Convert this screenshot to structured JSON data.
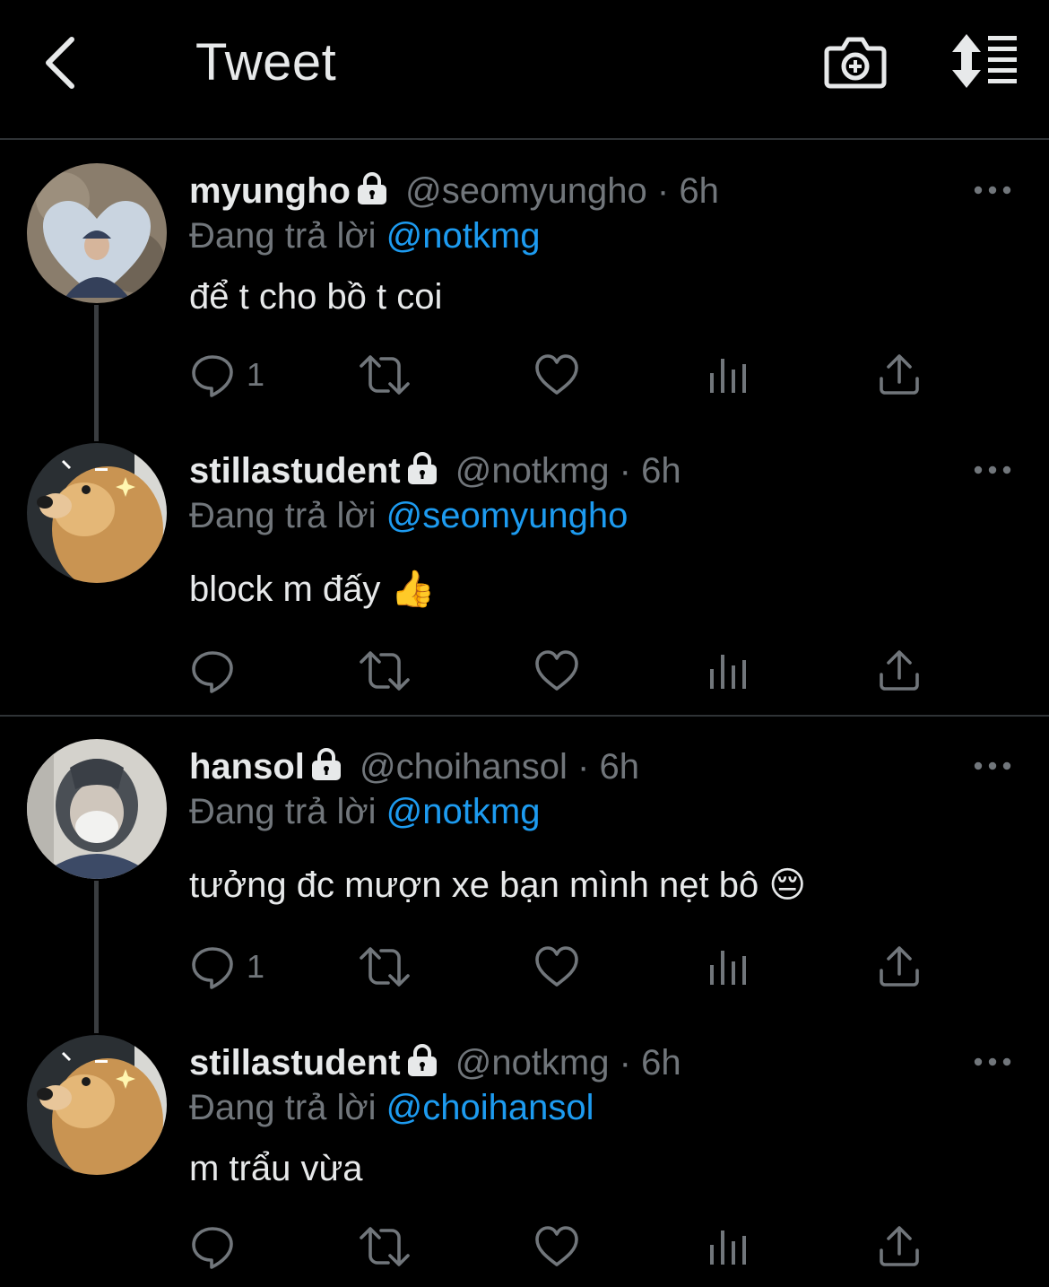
{
  "header": {
    "title": "Tweet",
    "back_icon": "chevron-left-icon",
    "camera_icon": "camera-plus-icon",
    "sort_icon": "sort-icon"
  },
  "colors": {
    "background": "#000000",
    "link": "#1d9bf0",
    "muted": "#71767b",
    "text": "#e7e9ea"
  },
  "tweets": [
    {
      "name": "myungho",
      "handle": "@seomyungho",
      "dot": "·",
      "time": "6h",
      "reply_prefix": "Đang trả lời",
      "reply_to": "@notkmg",
      "text": "để t cho bồ t coi",
      "reply_count": "1",
      "avatar": "avatar-heart-photo"
    },
    {
      "name": "stillastudent",
      "handle": "@notkmg",
      "dot": "·",
      "time": "6h",
      "reply_prefix": "Đang trả lời",
      "reply_to": "@seomyungho",
      "text": "block m đấy 👍",
      "reply_count": "",
      "avatar": "avatar-golden-retriever"
    },
    {
      "name": "hansol",
      "handle": "@choihansol",
      "dot": "·",
      "time": "6h",
      "reply_prefix": "Đang trả lời",
      "reply_to": "@notkmg",
      "text": "tưởng đc mượn xe bạn mình nẹt bô 😔",
      "reply_count": "1",
      "avatar": "avatar-hooded-mask"
    },
    {
      "name": "stillastudent",
      "handle": "@notkmg",
      "dot": "·",
      "time": "6h",
      "reply_prefix": "Đang trả lời",
      "reply_to": "@choihansol",
      "text": "m trẩu vừa",
      "reply_count": "",
      "avatar": "avatar-golden-retriever"
    }
  ]
}
